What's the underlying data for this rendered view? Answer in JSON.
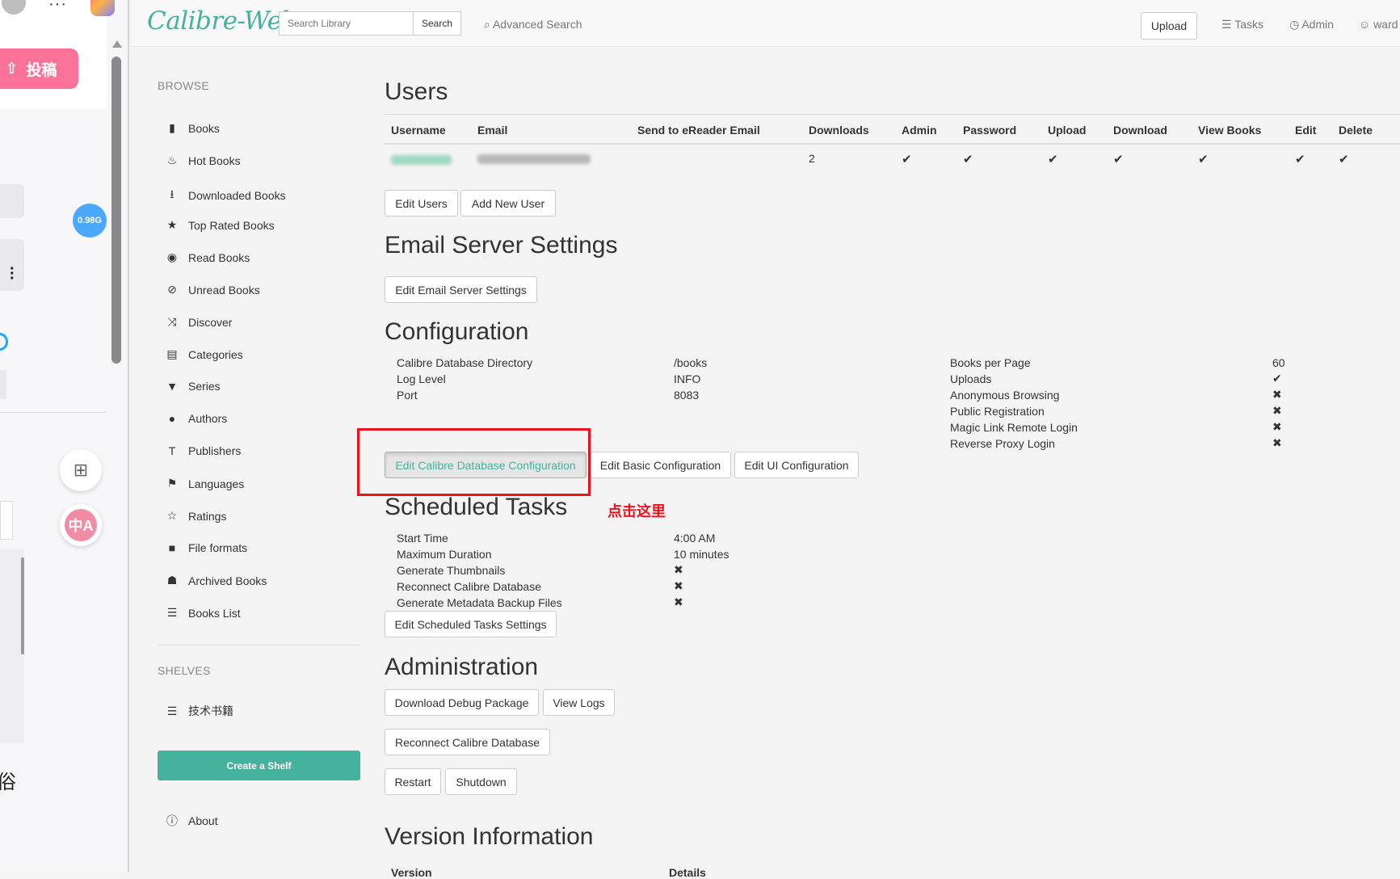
{
  "strip": {
    "upload_label": "投稿",
    "storage_badge": "0.98G",
    "translate_label": "中A",
    "partial_char": "俗"
  },
  "navbar": {
    "logo": "Calibre-Web",
    "search_placeholder": "Search Library",
    "search_button": "Search",
    "advanced_search": "Advanced Search",
    "upload_button": "Upload",
    "tasks": "Tasks",
    "admin": "Admin",
    "user": "ward"
  },
  "sidebar": {
    "browse_title": "BROWSE",
    "items": [
      {
        "label": "Books",
        "icon": "book-icon"
      },
      {
        "label": "Hot Books",
        "icon": "fire-icon"
      },
      {
        "label": "Downloaded Books",
        "icon": "download-circle-icon"
      },
      {
        "label": "Top Rated Books",
        "icon": "star-icon"
      },
      {
        "label": "Read Books",
        "icon": "eye-icon"
      },
      {
        "label": "Unread Books",
        "icon": "eye-slash-icon"
      },
      {
        "label": "Discover",
        "icon": "shuffle-icon"
      },
      {
        "label": "Categories",
        "icon": "inbox-icon"
      },
      {
        "label": "Series",
        "icon": "bookmark-icon"
      },
      {
        "label": "Authors",
        "icon": "user-icon"
      },
      {
        "label": "Publishers",
        "icon": "text-size-icon"
      },
      {
        "label": "Languages",
        "icon": "flag-icon"
      },
      {
        "label": "Ratings",
        "icon": "star-empty-icon"
      },
      {
        "label": "File formats",
        "icon": "file-icon"
      },
      {
        "label": "Archived Books",
        "icon": "trash-icon"
      },
      {
        "label": "Books List",
        "icon": "list-icon"
      }
    ],
    "shelves_title": "SHELVES",
    "shelves": [
      {
        "label": "技术书籍",
        "icon": "list-icon"
      }
    ],
    "create_shelf": "Create a Shelf",
    "about": "About"
  },
  "users": {
    "title": "Users",
    "headers": [
      "Username",
      "Email",
      "Send to eReader Email",
      "Downloads",
      "Admin",
      "Password",
      "Upload",
      "Download",
      "View Books",
      "Edit",
      "Delete"
    ],
    "row": {
      "downloads": "2",
      "check": "✔"
    },
    "edit_users": "Edit Users",
    "add_new_user": "Add New User"
  },
  "email": {
    "title": "Email Server Settings",
    "edit_button": "Edit Email Server Settings"
  },
  "configuration": {
    "title": "Configuration",
    "left": [
      {
        "label": "Calibre Database Directory",
        "value": "/books"
      },
      {
        "label": "Log Level",
        "value": "INFO"
      },
      {
        "label": "Port",
        "value": "8083"
      }
    ],
    "right": [
      {
        "label": "Books per Page",
        "value": "60"
      },
      {
        "label": "Uploads",
        "value": "✔"
      },
      {
        "label": "Anonymous Browsing",
        "value": "✖"
      },
      {
        "label": "Public Registration",
        "value": "✖"
      },
      {
        "label": "Magic Link Remote Login",
        "value": "✖"
      },
      {
        "label": "Reverse Proxy Login",
        "value": "✖"
      }
    ],
    "edit_db": "Edit Calibre Database Configuration",
    "edit_basic": "Edit Basic Configuration",
    "edit_ui": "Edit UI Configuration",
    "annotation": "点击这里"
  },
  "scheduled": {
    "title": "Scheduled Tasks",
    "rows": [
      {
        "label": "Start Time",
        "value": "4:00 AM"
      },
      {
        "label": "Maximum Duration",
        "value": "10 minutes"
      },
      {
        "label": "Generate Thumbnails",
        "value": "✖"
      },
      {
        "label": "Reconnect Calibre Database",
        "value": "✖"
      },
      {
        "label": "Generate Metadata Backup Files",
        "value": "✖"
      }
    ],
    "edit_button": "Edit Scheduled Tasks Settings"
  },
  "administration": {
    "title": "Administration",
    "debug": "Download Debug Package",
    "logs": "View Logs",
    "reconnect": "Reconnect Calibre Database",
    "restart": "Restart",
    "shutdown": "Shutdown"
  },
  "version": {
    "title": "Version Information",
    "col1": "Version",
    "col2": "Details"
  }
}
